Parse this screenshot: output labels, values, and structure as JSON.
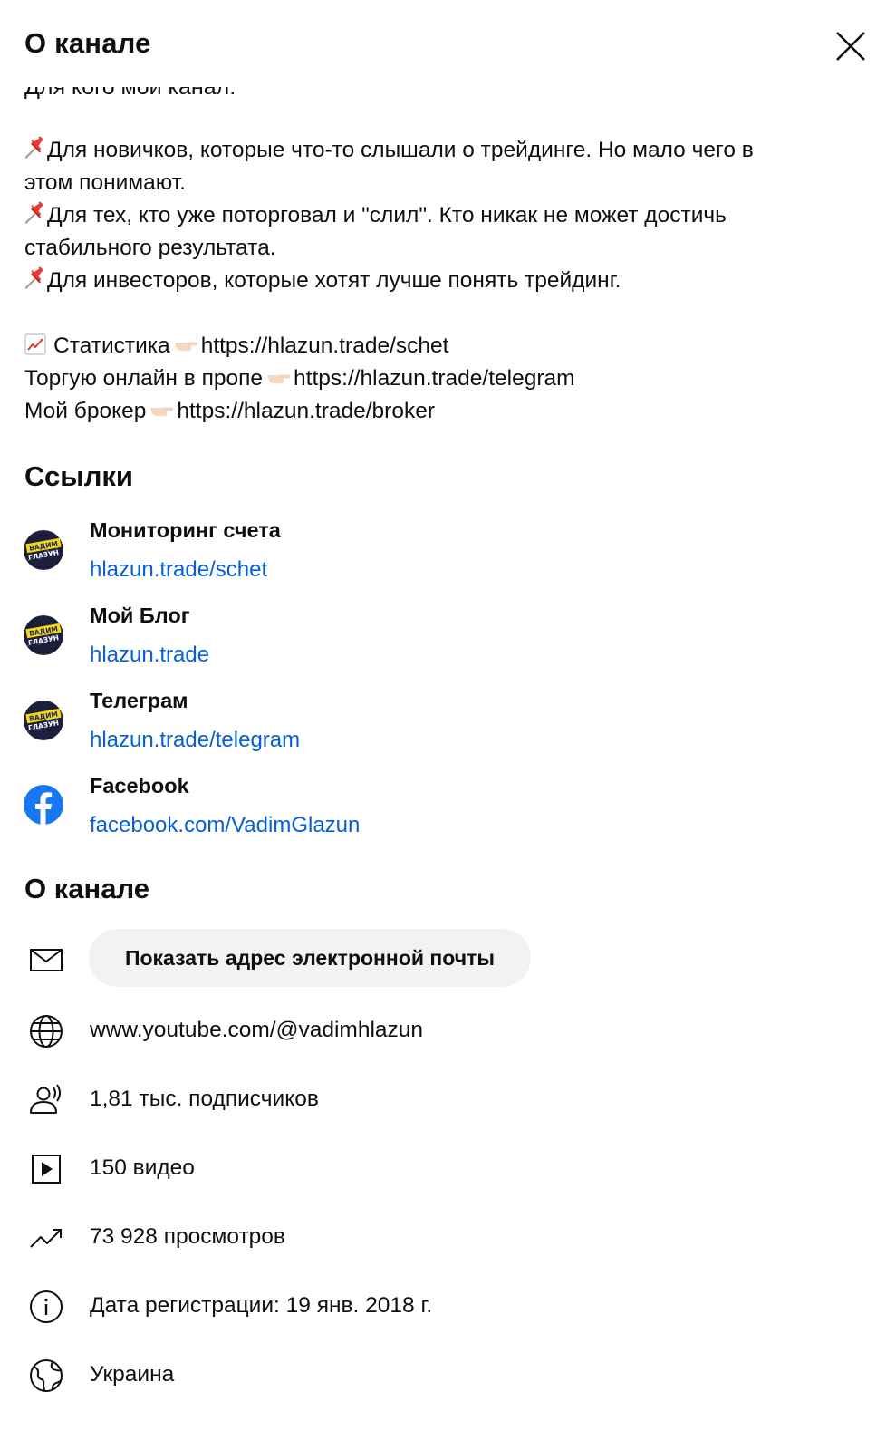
{
  "header": {
    "title": "О канале"
  },
  "description": {
    "cut_line": "Для кого мой канал:",
    "bullet1_a": "Для новичков, которые что-то слышали о трейдинге. Но мало чего в",
    "bullet1_b": "этом понимают.",
    "bullet2_a": "Для тех, кто уже поторговал и \"слил\". Кто никак не может достичь",
    "bullet2_b": "стабильного результата.",
    "bullet3": "Для инвесторов, которые хотят лучше понять трейдинг.",
    "stats_label": "Статистика",
    "stats_url": "https://hlazun.trade/schet",
    "prop_label": "Торгую онлайн в пропе",
    "prop_url": "https://hlazun.trade/telegram",
    "broker_label": "Мой брокер",
    "broker_url": "https://hlazun.trade/broker"
  },
  "links": {
    "title": "Ссылки",
    "items": [
      {
        "title": "Мониторинг счета",
        "url": "hlazun.trade/schet",
        "icon": "channel-avatar"
      },
      {
        "title": "Мой Блог",
        "url": "hlazun.trade",
        "icon": "channel-avatar"
      },
      {
        "title": "Телеграм",
        "url": "hlazun.trade/telegram",
        "icon": "channel-avatar"
      },
      {
        "title": "Facebook",
        "url": "facebook.com/VadimGlazun",
        "icon": "facebook-icon"
      }
    ]
  },
  "avatar_text": {
    "line1": "ВАДИМ",
    "line2": "ГЛАЗУН"
  },
  "about": {
    "title": "О канале",
    "email_button": "Показать адрес электронной почты",
    "channel_url": "www.youtube.com/@vadimhlazun",
    "subscribers": "1,81 тыс. подписчиков",
    "videos": "150 видео",
    "views": "73 928 просмотров",
    "joined": "Дата регистрации: 19 янв. 2018 г.",
    "country": "Украина"
  },
  "colors": {
    "link": "#065fd4",
    "text": "#0f0f0f",
    "button_bg": "#f2f2f2",
    "facebook": "#1877f2"
  }
}
